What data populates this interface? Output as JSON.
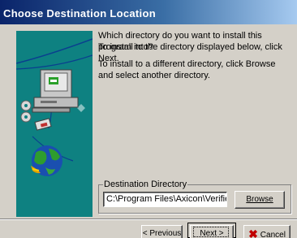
{
  "window": {
    "title": "Choose Destination Location"
  },
  "main": {
    "question": "Which directory do you want to install this program into?",
    "instruction_next": "To install to the directory displayed below, click Next.",
    "instruction_browse": "To install to a different directory, click Browse and select another directory."
  },
  "destination": {
    "group_label": "Destination Directory",
    "path": "C:\\Program Files\\Axicon\\Verifier",
    "browse_label": "Browse"
  },
  "footer": {
    "previous_label": "< Previous",
    "next_label": "Next >",
    "cancel_label": "Cancel"
  },
  "icons": {
    "artwork": "install-computer-globe-artwork",
    "cancel": "red-x-icon"
  },
  "colors": {
    "title_bar_start": "#0a246a",
    "title_bar_end": "#a6caf0",
    "artwork_background": "#0e8181",
    "dialog_face": "#d4d0c8"
  }
}
